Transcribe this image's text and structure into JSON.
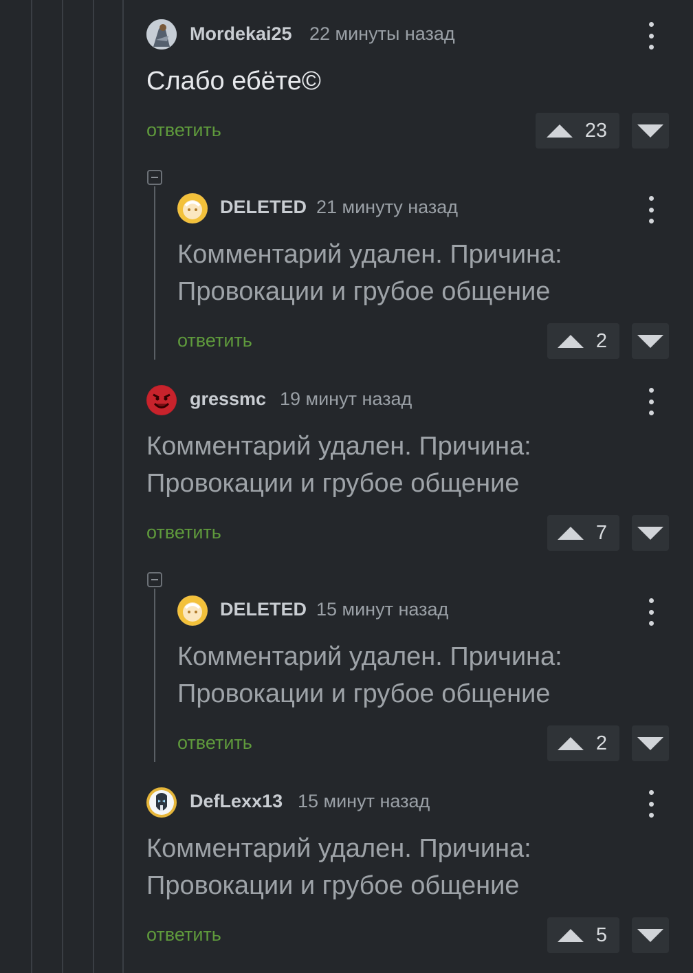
{
  "reply_label": "ответить",
  "comments": [
    {
      "author": "Mordekai25",
      "time": "22 минуты назад",
      "text_lines": [
        "Слабо ебёте©"
      ],
      "votes": "23",
      "avatar": "mordekai-avatar"
    },
    {
      "author": "DELETED",
      "time": "21 минуту назад",
      "text_lines": [
        "Комментарий удален. Причина:",
        "Провокации и грубое общение"
      ],
      "votes": "2",
      "avatar": "deleted-avatar"
    },
    {
      "author": "gressmc",
      "time": "19 минут назад",
      "text_lines": [
        "Комментарий удален. Причина:",
        "Провокации и грубое общение"
      ],
      "votes": "7",
      "avatar": "gressmc-avatar"
    },
    {
      "author": "DELETED",
      "time": "15 минут назад",
      "text_lines": [
        "Комментарий удален. Причина:",
        "Провокации и грубое общение"
      ],
      "votes": "2",
      "avatar": "deleted-avatar"
    },
    {
      "author": "DefLexx13",
      "time": "15 минут назад",
      "text_lines": [
        "Комментарий удален. Причина:",
        "Провокации и грубое общение"
      ],
      "votes": "5",
      "avatar": "deflexx-avatar"
    }
  ],
  "colors": {
    "background": "#24272b",
    "reply": "#5f9a3c",
    "vote_box": "#2f3337"
  }
}
